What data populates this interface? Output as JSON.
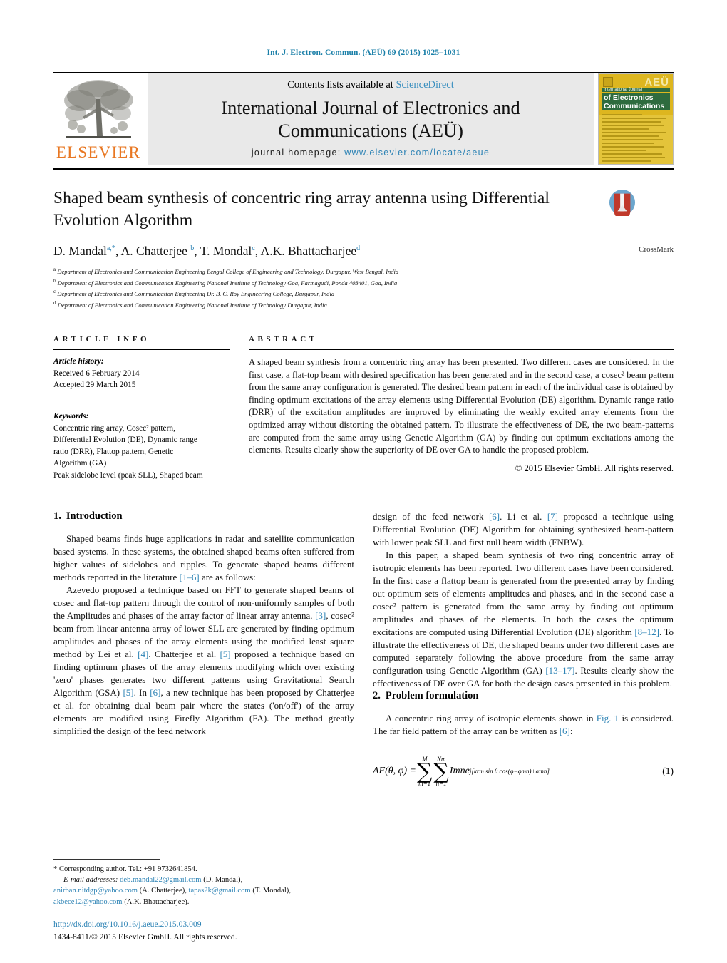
{
  "running_head": "Int. J. Electron. Commun. (AEÜ) 69 (2015) 1025–1031",
  "masthead": {
    "contents_prefix": "Contents lists available at ",
    "sciencedirect": "ScienceDirect",
    "journal_title_line1": "International Journal of Electronics and",
    "journal_title_line2": "Communications (AEÜ)",
    "homepage_label": "journal homepage:",
    "homepage_url": "www.elsevier.com/locate/aeue",
    "publisher": "ELSEVIER",
    "cover": {
      "aeu": "AEÜ",
      "line1": "International Journal",
      "line2": "of Electronics and",
      "line3": "Communications"
    }
  },
  "article": {
    "title_line1": "Shaped beam synthesis of concentric ring array antenna using",
    "title_line2": "Differential Evolution Algorithm",
    "authors": "D. Mandal, A. Chatterjee, T. Mondal, A.K. Bhattacharjee",
    "author_list": [
      {
        "name": "D. Mandal",
        "sup": "a,*"
      },
      {
        "name": "A. Chatterjee",
        "sup": "b"
      },
      {
        "name": "T. Mondal",
        "sup": "c"
      },
      {
        "name": "A.K. Bhattacharjee",
        "sup": "d"
      }
    ],
    "affiliations": [
      {
        "mark": "a",
        "text": "Department of Electronics and Communication Engineering Bengal College of Engineering and Technology, Durgapur, West Bengal, India"
      },
      {
        "mark": "b",
        "text": "Department of Electronics and Communication Engineering National Institute of Technology Goa, Farmagudi, Ponda 403401, Goa, India"
      },
      {
        "mark": "c",
        "text": "Department of Electronics and Communication Engineering Dr. B. C. Roy Engineering College, Durgapur, India"
      },
      {
        "mark": "d",
        "text": "Department of Electronics and Communication Engineering National Institute of Technology Durgapur, India"
      }
    ],
    "crossmark_label": "CrossMark"
  },
  "article_info": {
    "heading": "ARTICLE INFO",
    "history_label": "Article history:",
    "history": [
      "Received 6 February 2014",
      "Accepted 29 March 2015"
    ],
    "keywords_label": "Keywords:",
    "keywords_lines": [
      "Concentric ring array, Cosec² pattern,",
      "Differential Evolution (DE), Dynamic range",
      "ratio (DRR), Flattop pattern, Genetic",
      "Algorithm (GA)",
      "Peak sidelobe level (peak SLL), Shaped beam"
    ]
  },
  "abstract": {
    "heading": "ABSTRACT",
    "text": "A shaped beam synthesis from a concentric ring array has been presented. Two different cases are considered. In the first case, a flat-top beam with desired specification has been generated and in the second case, a cosec² beam pattern from the same array configuration is generated. The desired beam pattern in each of the individual case is obtained by finding optimum excitations of the array elements using Differential Evolution (DE) algorithm. Dynamic range ratio (DRR) of the excitation amplitudes are improved by eliminating the weakly excited array elements from the optimized array without distorting the obtained pattern. To illustrate the effectiveness of DE, the two beam-patterns are computed from the same array using Genetic Algorithm (GA) by finding out optimum excitations among the elements. Results clearly show the superiority of DE over GA to handle the proposed problem.",
    "copyright": "© 2015 Elsevier GmbH. All rights reserved."
  },
  "body": {
    "section1_number": "1.",
    "section1_title": "Introduction",
    "p1_a": "Shaped beams finds huge applications in radar and satellite communication based systems. In these systems, the obtained shaped beams often suffered from higher values of sidelobes and ripples. To generate shaped beams different methods reported in the literature ",
    "p1_ref": "[1–6]",
    "p1_b": " are as follows:",
    "p2_a": "Azevedo proposed a technique based on FFT to generate shaped beams of cosec and flat-top pattern through the control of non-uniformly samples of both the Amplitudes and phases of the array factor of linear array antenna. ",
    "p2_r1": "[3]",
    "p2_b": ", cosec² beam from linear antenna array of lower SLL are generated by finding optimum amplitudes and phases of the array elements using the modified least square method by Lei et al. ",
    "p2_r2": "[4]",
    "p2_c": ". Chatterjee et al. ",
    "p2_r3": "[5]",
    "p2_d": " proposed a technique based on finding optimum phases of the array elements modifying which over existing 'zero' phases generates two different patterns using Gravitational Search Algorithm (GSA) ",
    "p2_r4": "[5]",
    "p2_e": ". In ",
    "p2_r5": "[6]",
    "p2_f": ", a new technique has been proposed by Chatterjee et al. for obtaining dual beam pair where the states ('on/off') of the array elements are modified using Firefly Algorithm (FA). The method greatly simplified the design of the feed network ",
    "p2_r6": "[6]",
    "p2_g": ". Li et al. ",
    "p2_r7": "[7]",
    "p2_h": " proposed a technique using Differential Evolution (DE) Algorithm for obtaining synthesized beam-pattern with lower peak SLL and first null beam width (FNBW).",
    "p3_a": "In this paper, a shaped beam synthesis of two ring concentric array of isotropic elements has been reported. Two different cases have been considered. In the first case a flattop beam is generated from the presented array by finding out optimum sets of elements amplitudes and phases, and in the second case a cosec² pattern is generated from the same array by finding out optimum amplitudes and phases of the elements. In both the cases the optimum excitations are computed using Differential Evolution (DE) algorithm ",
    "p3_r1": "[8–12]",
    "p3_b": ". To illustrate the effectiveness of DE, the shaped beams under two different cases are computed separately following the above procedure from the same array configuration using Genetic Algorithm (GA) ",
    "p3_r2": "[13–17]",
    "p3_c": ". Results clearly show the effectiveness of DE over GA for both the design cases presented in this problem.",
    "section2_number": "2.",
    "section2_title": "Problem formulation",
    "p4_a": "A concentric ring array of isotropic elements shown in ",
    "p4_figref": "Fig. 1",
    "p4_b": " is considered. The far field pattern of the array can be written as ",
    "p4_ref": "[6]",
    "p4_c": ":"
  },
  "equation": {
    "lhs": "AF(θ, φ) =",
    "sum1_top": "M",
    "sum1_bottom": "m=1",
    "sum2_top": "Nm",
    "sum2_bottom": "n=1",
    "term": "Imn",
    "exponent": "j[krm sin θ cos(φ−φmn)+αmn]",
    "number": "(1)"
  },
  "footer": {
    "corresponding_star": "*",
    "corresponding": "Corresponding author. Tel.: +91 9732641854.",
    "email_label": "E-mail addresses:",
    "emails": [
      {
        "addr": "deb.mandal22@gmail.com",
        "owner": "(D. Mandal),"
      },
      {
        "addr": "anirban.nitdgp@yahoo.com",
        "owner": "(A. Chatterjee),"
      },
      {
        "addr": "tapas2k@gmail.com",
        "owner": "(T. Mondal),"
      },
      {
        "addr": "akbece12@yahoo.com",
        "owner": "(A.K. Bhattacharjee)."
      }
    ],
    "doi": "http://dx.doi.org/10.1016/j.aeue.2015.03.009",
    "issn_line": "1434-8411/© 2015 Elsevier GmbH. All rights reserved."
  }
}
